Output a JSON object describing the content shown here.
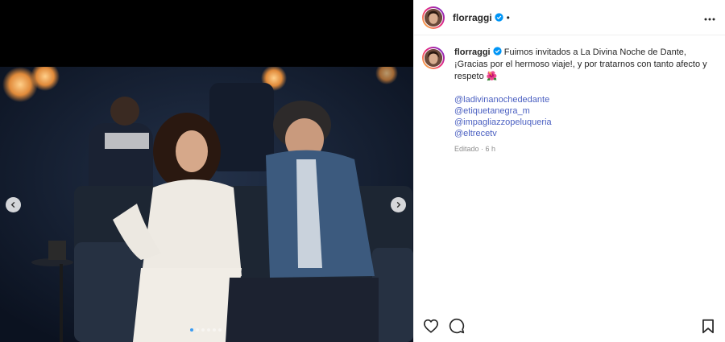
{
  "post": {
    "username": "florraggi",
    "separator": "•",
    "caption_user": "florraggi",
    "caption_text": "Fuimos invitados a La Divina Noche de Dante, ¡Gracias por el hermoso viaje!, y por tratarnos con tanto afecto y respeto 🌺",
    "tags": [
      "@ladivinanochededante",
      "@etiquetanegra_m",
      "@impagliazzopeluqueria",
      "@eltrecetv"
    ],
    "meta": "Editado · 6 h"
  },
  "carousel": {
    "total": 6,
    "current": 1
  },
  "icons": {
    "verified": "verified-badge-icon",
    "more": "more-options-icon",
    "prev": "chevron-left-icon",
    "next": "chevron-right-icon",
    "like": "heart-icon",
    "comment": "comment-icon",
    "save": "bookmark-icon"
  },
  "colors": {
    "accent": "#0095f6",
    "link": "#4a5fc1",
    "muted": "#8e8e8e"
  }
}
